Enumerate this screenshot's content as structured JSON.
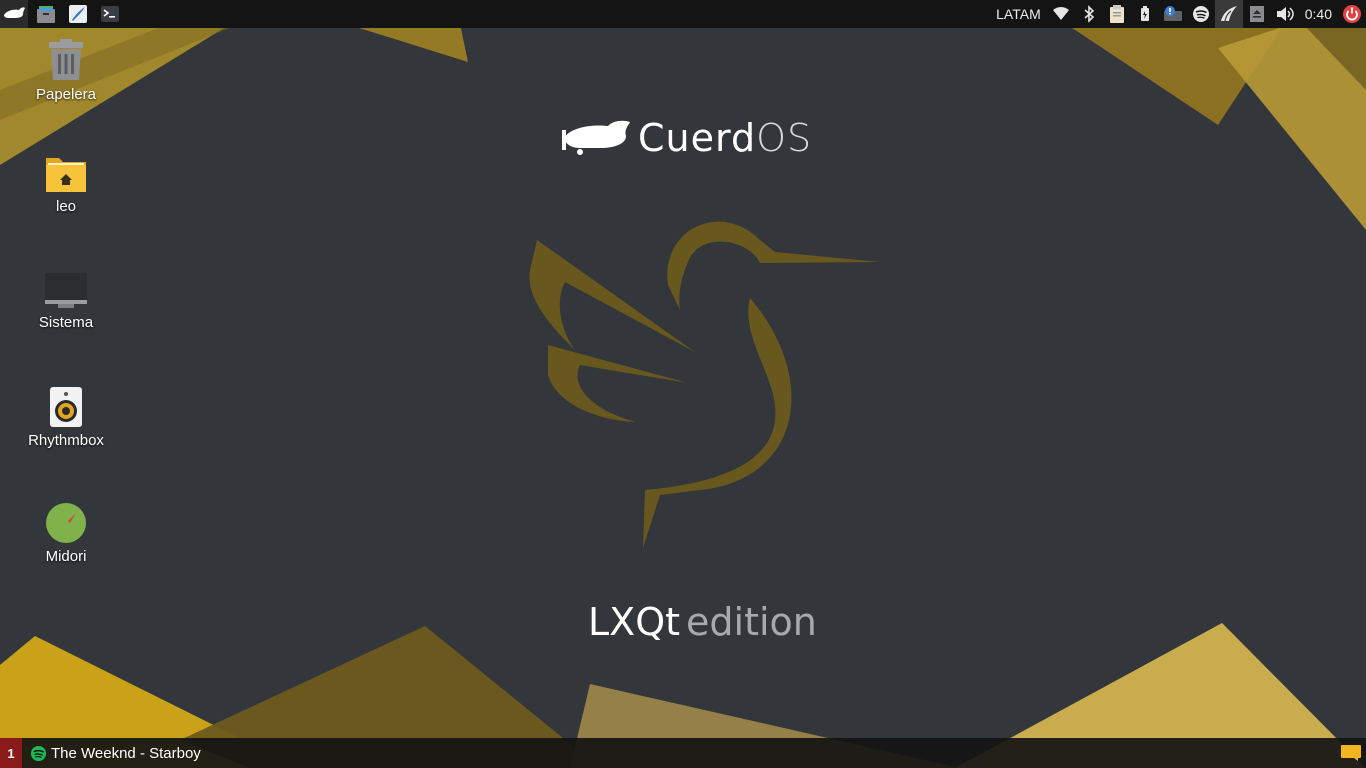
{
  "top_panel": {
    "launchers": [
      {
        "name": "cuerdos-menu-icon"
      },
      {
        "name": "file-manager-icon"
      },
      {
        "name": "text-editor-icon"
      },
      {
        "name": "terminal-icon"
      }
    ],
    "tray": {
      "keyboard_layout": "LATAM",
      "clock": "0:40"
    }
  },
  "desktop": {
    "icons": [
      {
        "label": "Papelera"
      },
      {
        "label": "leo"
      },
      {
        "label": "Sistema"
      },
      {
        "label": "Rhythmbox"
      },
      {
        "label": "Midori"
      }
    ]
  },
  "wallpaper": {
    "brand_part_a": "Cuerd",
    "brand_part_b": "OS",
    "edition_part_a": "LXQt",
    "edition_part_b": "edition",
    "accent_color": "#c9a21a",
    "background_color": "#33363b"
  },
  "bottom_panel": {
    "desktop_number": "1",
    "task": {
      "label": "The Weeknd - Starboy"
    }
  }
}
